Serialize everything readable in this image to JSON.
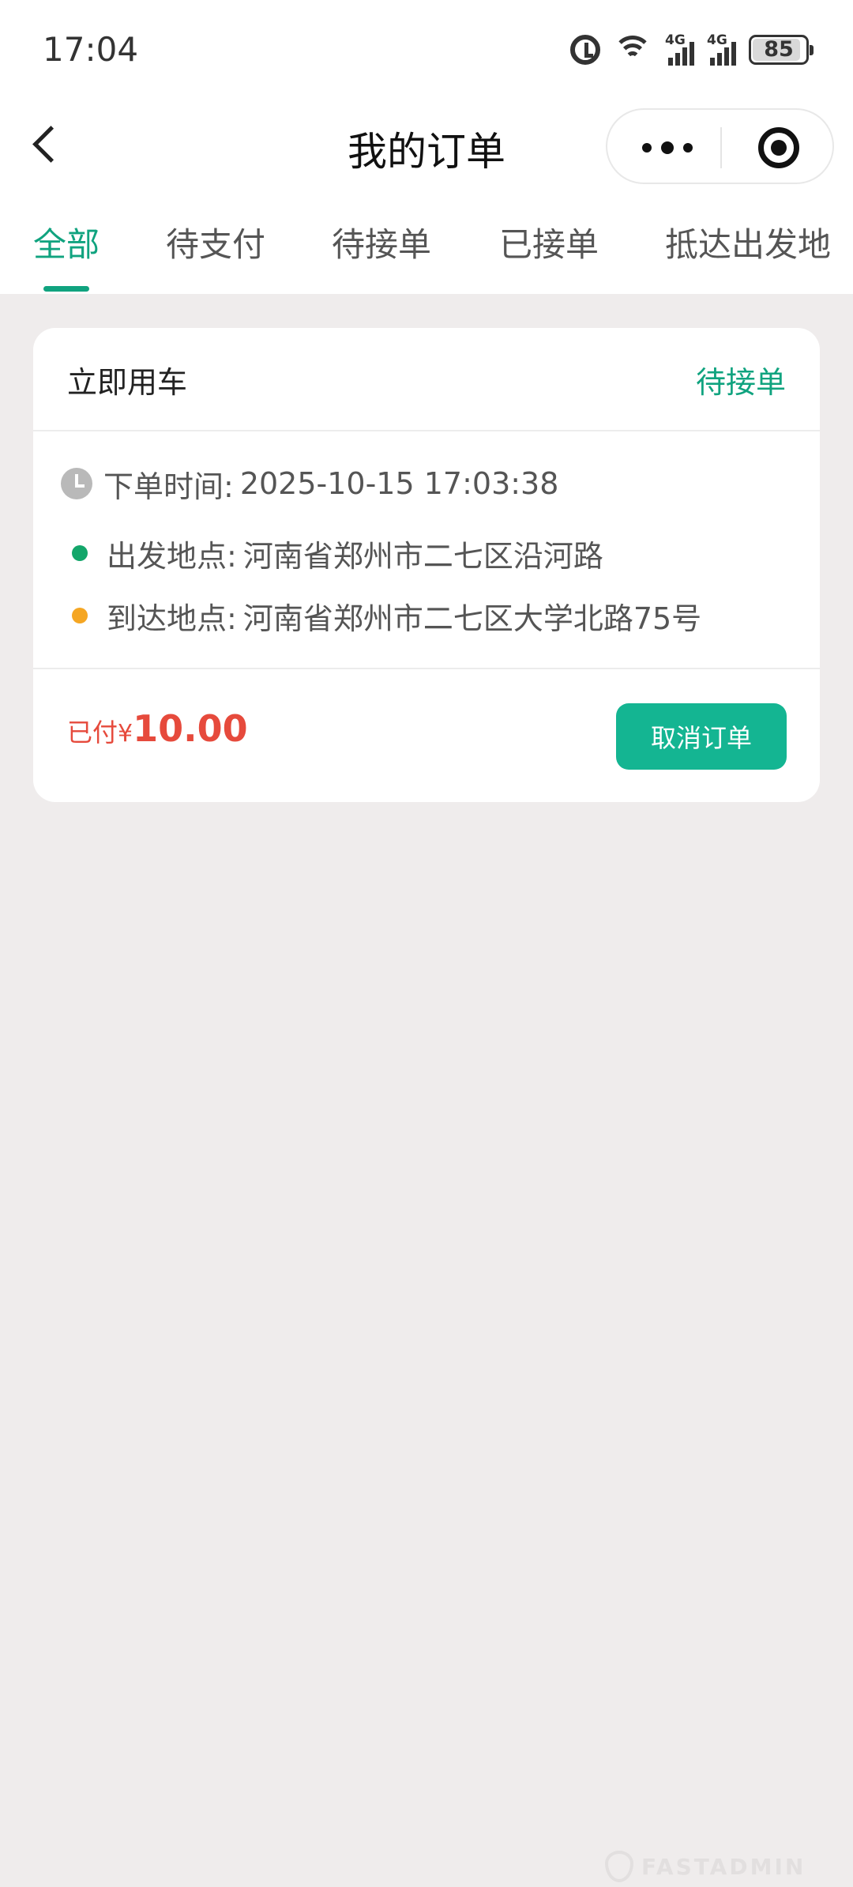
{
  "status_bar": {
    "time": "17:04",
    "network_1": "4G",
    "network_2": "4G",
    "battery": "85"
  },
  "header": {
    "title": "我的订单"
  },
  "tabs": [
    {
      "label": "全部",
      "active": true
    },
    {
      "label": "待支付"
    },
    {
      "label": "待接单"
    },
    {
      "label": "已接单"
    },
    {
      "label": "抵达出发地"
    }
  ],
  "order": {
    "type": "立即用车",
    "status": "待接单",
    "time_label": "下单时间:",
    "time_value": "2025-10-15 17:03:38",
    "from_label": "出发地点:",
    "from_value": "河南省郑州市二七区沿河路",
    "to_label": "到达地点:",
    "to_value": "河南省郑州市二七区大学北路75号",
    "paid_label": "已付",
    "currency": "¥",
    "amount": "10.00",
    "cancel_label": "取消订单"
  },
  "watermark": "FASTADMIN",
  "colors": {
    "accent": "#10a37f",
    "button": "#14b592",
    "price": "#e64a3c",
    "background": "#efecec"
  }
}
